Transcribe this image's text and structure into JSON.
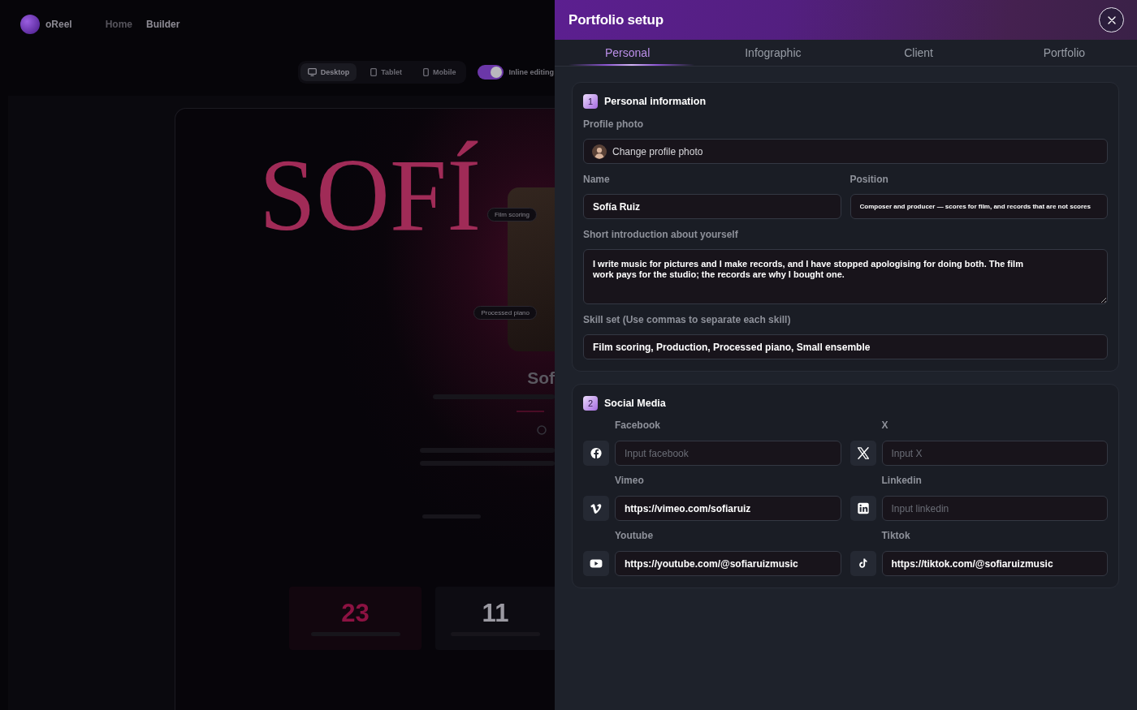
{
  "backdrop": {
    "brand": "oReel",
    "nav": [
      {
        "label": "Home",
        "selected": false
      },
      {
        "label": "Builder",
        "selected": true
      }
    ],
    "devices": [
      {
        "label": "Desktop",
        "selected": true
      },
      {
        "label": "Tablet",
        "selected": false
      },
      {
        "label": "Mobile",
        "selected": false
      }
    ],
    "inline_editing": {
      "label": "Inline editing",
      "on": true
    },
    "preview": {
      "hero_title": "SOFÍ",
      "chips": [
        "Film scoring",
        "Processed piano"
      ],
      "name": "Sof",
      "stats": [
        {
          "value": "23",
          "color": "#8c1242"
        },
        {
          "value": "11",
          "color": "#9b9aa2"
        }
      ]
    }
  },
  "panel": {
    "title": "Portfolio setup",
    "tabs": [
      {
        "label": "Personal",
        "selected": true
      },
      {
        "label": "Infographic",
        "selected": false
      },
      {
        "label": "Client",
        "selected": false
      },
      {
        "label": "Portfolio",
        "selected": false
      }
    ],
    "personal": {
      "number": "1",
      "title": "Personal information",
      "profile_photo": {
        "label": "Profile photo",
        "action": "Change profile photo"
      },
      "name": {
        "label": "Name",
        "value": "Sofía Ruiz"
      },
      "position": {
        "label": "Position",
        "value": "Composer and producer — scores for film, and records that are not scores"
      },
      "intro": {
        "label": "Short introduction about yourself",
        "value": "I write music for pictures and I make records, and I have stopped apologising for doing both. The film work pays for the studio; the records are why I bought one."
      },
      "skills": {
        "label": "Skill set (Use commas to separate each skill)",
        "value": "Film scoring, Production, Processed piano, Small ensemble"
      }
    },
    "social": {
      "number": "2",
      "title": "Social Media",
      "links": [
        {
          "kind": "facebook",
          "label": "Facebook",
          "placeholder": "Input facebook"
        },
        {
          "kind": "x",
          "label": "X",
          "placeholder": "Input X"
        },
        {
          "kind": "vimeo",
          "label": "Vimeo",
          "value": "https://vimeo.com/sofiaruiz"
        },
        {
          "kind": "linkedin",
          "label": "Linkedin",
          "placeholder": "Input linkedin"
        },
        {
          "kind": "youtube",
          "label": "Youtube",
          "value": "https://youtube.com/@sofiaruizmusic"
        },
        {
          "kind": "tiktok",
          "label": "Tiktok",
          "value": "https://tiktok.com/@sofiaruizmusic"
        }
      ]
    }
  }
}
